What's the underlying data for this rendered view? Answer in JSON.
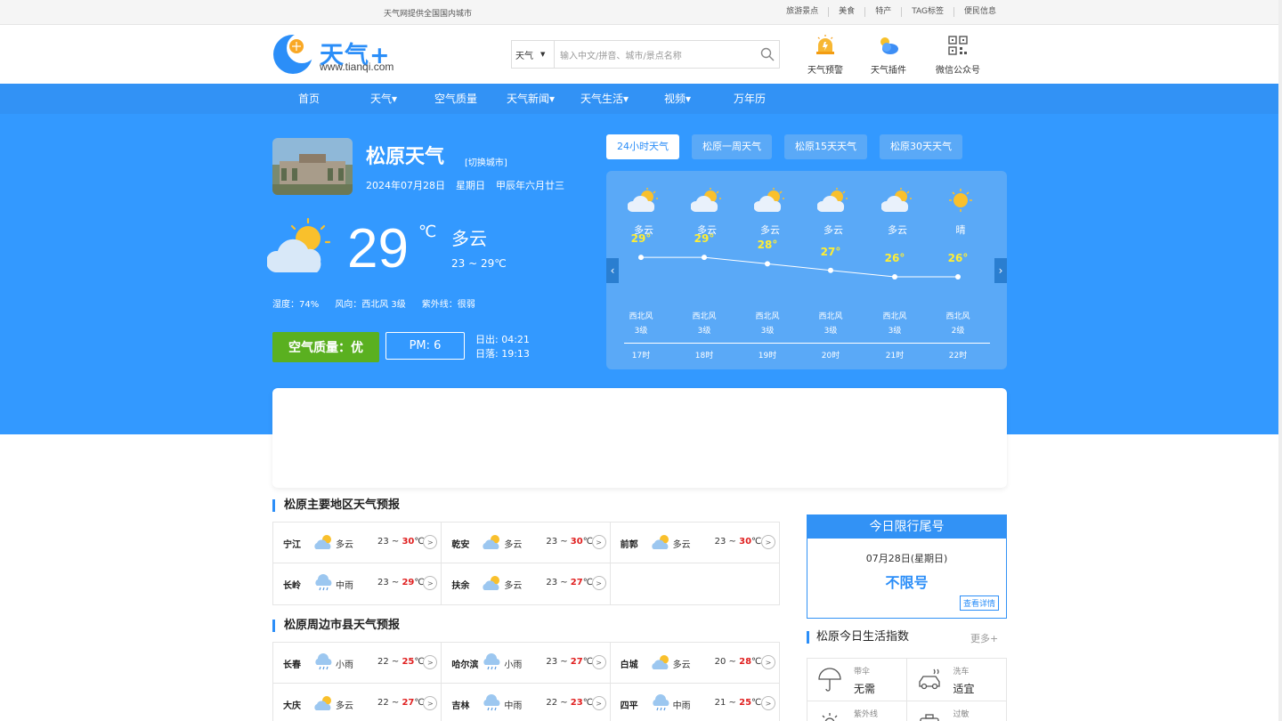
{
  "topbar": {
    "notice": "天气网提供全国国内城市",
    "links": [
      "旅游景点",
      "美食",
      "特产",
      "TAG标签",
      "便民信息"
    ]
  },
  "header": {
    "logo_name": "天气+",
    "logo_url": "www.tianqi.com",
    "search_select": "天气",
    "search_placeholder": "输入中文/拼音、城市/景点名称",
    "icons": [
      {
        "label": "天气预警",
        "icon": "alert-icon"
      },
      {
        "label": "天气插件",
        "icon": "plugin-icon"
      },
      {
        "label": "微信公众号",
        "icon": "qrcode-icon"
      }
    ]
  },
  "nav": [
    "首页",
    "天气▾",
    "空气质量",
    "天气新闻▾",
    "天气生活▾",
    "视频▾",
    "万年历"
  ],
  "current": {
    "city": "松原天气",
    "switch": "[切换城市]",
    "date": "2024年07月28日",
    "weekday": "星期日",
    "lunar": "甲辰年六月廿三",
    "temp": "29",
    "unit": "℃",
    "condition": "多云",
    "range": "23 ~ 29℃",
    "humidity": "湿度：74%",
    "wind": "风向：西北风 3级",
    "uv": "紫外线：很弱",
    "aqi": "空气质量：优",
    "pm": "PM: 6",
    "sunrise": "日出: 04:21",
    "sunset": "日落: 19:13"
  },
  "tabs": [
    "24小时天气",
    "松原一周天气",
    "松原15天天气",
    "松原30天天气"
  ],
  "hourly": [
    {
      "cond": "多云",
      "temp": "29°",
      "t": 29,
      "wind": "西北风",
      "level": "3级",
      "hour": "17时"
    },
    {
      "cond": "多云",
      "temp": "29°",
      "t": 29,
      "wind": "西北风",
      "level": "3级",
      "hour": "18时"
    },
    {
      "cond": "多云",
      "temp": "28°",
      "t": 28,
      "wind": "西北风",
      "level": "3级",
      "hour": "19时"
    },
    {
      "cond": "多云",
      "temp": "27°",
      "t": 27,
      "wind": "西北风",
      "level": "3级",
      "hour": "20时"
    },
    {
      "cond": "多云",
      "temp": "26°",
      "t": 26,
      "wind": "西北风",
      "level": "3级",
      "hour": "21时"
    },
    {
      "cond": "晴",
      "temp": "26°",
      "t": 26,
      "wind": "西北风",
      "level": "2级",
      "hour": "22时"
    }
  ],
  "main_areas": {
    "title": "松原主要地区天气预报",
    "rows": [
      [
        {
          "city": "宁江",
          "cond": "多云",
          "low": "23 ~ ",
          "high": "30",
          "unit": "℃",
          "icon": "cloudy"
        },
        {
          "city": "乾安",
          "cond": "多云",
          "low": "23 ~ ",
          "high": "30",
          "unit": "℃",
          "icon": "cloudy"
        },
        {
          "city": "前郭",
          "cond": "多云",
          "low": "23 ~ ",
          "high": "30",
          "unit": "℃",
          "icon": "cloudy"
        }
      ],
      [
        {
          "city": "长岭",
          "cond": "中雨",
          "low": "23 ~ ",
          "high": "29",
          "unit": "℃",
          "icon": "rain"
        },
        {
          "city": "扶余",
          "cond": "多云",
          "low": "23 ~ ",
          "high": "27",
          "unit": "℃",
          "icon": "cloudy"
        }
      ]
    ]
  },
  "nearby": {
    "title": "松原周边市县天气预报",
    "rows": [
      [
        {
          "city": "长春",
          "cond": "小雨",
          "low": "22 ~ ",
          "high": "25",
          "unit": "℃",
          "icon": "rain"
        },
        {
          "city": "哈尔滨",
          "cond": "小雨",
          "low": "23 ~ ",
          "high": "27",
          "unit": "℃",
          "icon": "rain"
        },
        {
          "city": "白城",
          "cond": "多云",
          "low": "20 ~ ",
          "high": "28",
          "unit": "℃",
          "icon": "cloudy"
        }
      ],
      [
        {
          "city": "大庆",
          "cond": "多云",
          "low": "22 ~ ",
          "high": "27",
          "unit": "℃",
          "icon": "cloudy"
        },
        {
          "city": "吉林",
          "cond": "中雨",
          "low": "22 ~ ",
          "high": "23",
          "unit": "℃",
          "icon": "rain"
        },
        {
          "city": "四平",
          "cond": "中雨",
          "low": "21 ~ ",
          "high": "25",
          "unit": "℃",
          "icon": "rain"
        }
      ]
    ]
  },
  "limit": {
    "title": "今日限行尾号",
    "date": "07月28日(星期日)",
    "value": "不限号",
    "more": "查看详情"
  },
  "life": {
    "title": "松原今日生活指数",
    "more": "更多+",
    "items": [
      {
        "key": "带伞",
        "val": "无需",
        "icon": "umbrella-icon"
      },
      {
        "key": "洗车",
        "val": "适宜",
        "icon": "car-wash-icon"
      },
      {
        "key": "紫外线",
        "val": "",
        "icon": "uv-icon"
      },
      {
        "key": "过敏",
        "val": "",
        "icon": "allergy-icon"
      }
    ]
  },
  "colors": {
    "accent": "#3292f5",
    "hero": "#3399ff",
    "aqi": "#5ab020",
    "hot": "#e02020",
    "hourly_temp": "#ffee33"
  }
}
